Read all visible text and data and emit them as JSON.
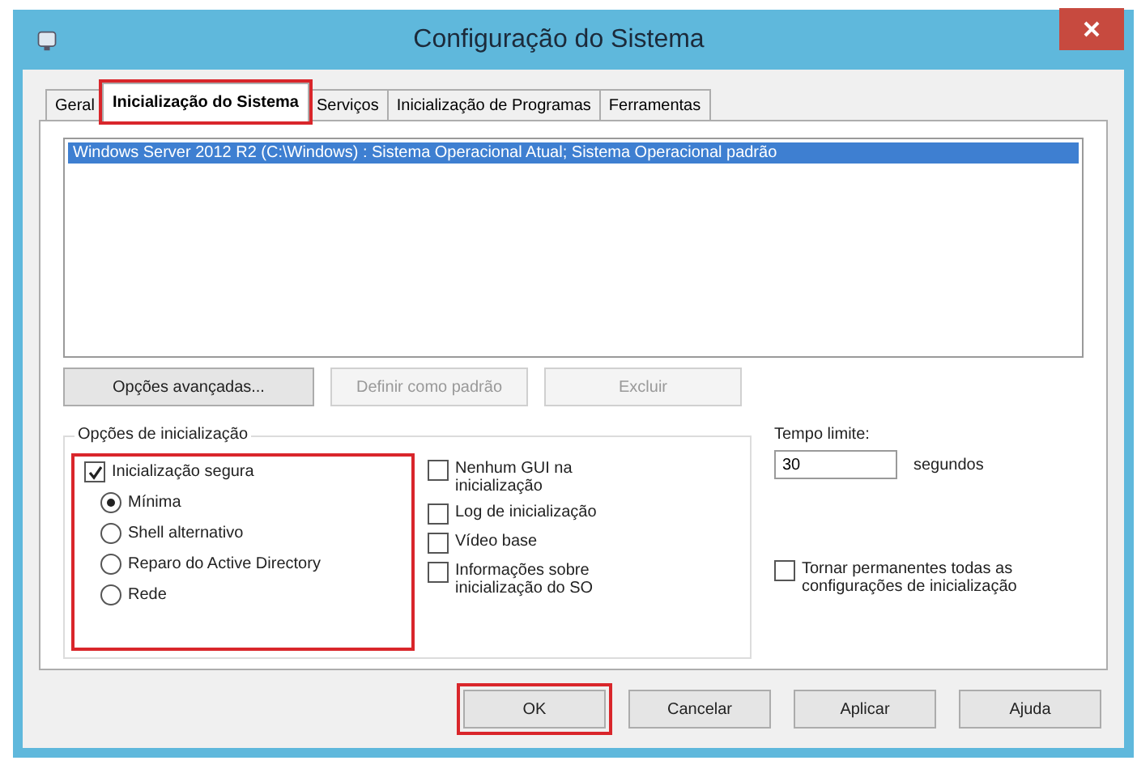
{
  "window": {
    "title": "Configuração do Sistema"
  },
  "tabs": [
    {
      "label": "Geral",
      "selected": false,
      "highlighted": false
    },
    {
      "label": "Inicialização do Sistema",
      "selected": true,
      "highlighted": true
    },
    {
      "label": "Serviços",
      "selected": false,
      "highlighted": false
    },
    {
      "label": "Inicialização de Programas",
      "selected": false,
      "highlighted": false
    },
    {
      "label": "Ferramentas",
      "selected": false,
      "highlighted": false
    }
  ],
  "os_list": [
    {
      "label": "Windows Server 2012 R2 (C:\\Windows) : Sistema Operacional Atual; Sistema Operacional padrão",
      "selected": true
    }
  ],
  "list_buttons": [
    {
      "label": "Opções avançadas...",
      "disabled": false
    },
    {
      "label": "Definir como padrão",
      "disabled": true
    },
    {
      "label": "Excluir",
      "disabled": true
    }
  ],
  "boot_options": {
    "title": "Opções de inicialização",
    "safe_boot": {
      "label": "Inicialização segura",
      "checked": true,
      "highlighted": true,
      "options": [
        {
          "label": "Mínima",
          "selected": true
        },
        {
          "label": "Shell alternativo",
          "selected": false
        },
        {
          "label": "Reparo do Active Directory",
          "selected": false
        },
        {
          "label": "Rede",
          "selected": false
        }
      ]
    },
    "checkboxes": [
      {
        "label": "Nenhum GUI na inicialização",
        "checked": false
      },
      {
        "label": "Log de inicialização",
        "checked": false
      },
      {
        "label": "Vídeo base",
        "checked": false
      },
      {
        "label": "Informações sobre inicialização do SO",
        "checked": false
      }
    ]
  },
  "timeout": {
    "label": "Tempo limite:",
    "value": "30",
    "unit": "segundos"
  },
  "make_permanent": {
    "label": "Tornar permanentes todas as configurações de inicialização",
    "checked": false
  },
  "buttons": [
    {
      "label": "OK",
      "highlighted": true
    },
    {
      "label": "Cancelar",
      "highlighted": false
    },
    {
      "label": "Aplicar",
      "highlighted": false
    },
    {
      "label": "Ajuda",
      "highlighted": false
    }
  ]
}
